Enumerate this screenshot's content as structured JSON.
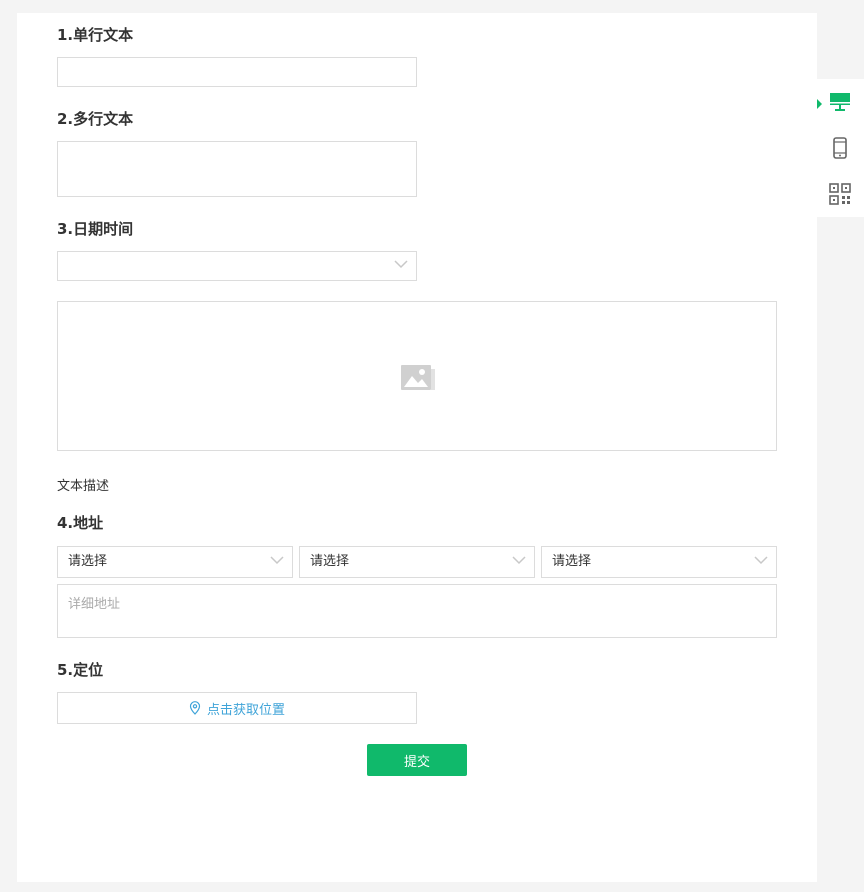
{
  "form": {
    "q1_title": "1.单行文本",
    "q2_title": "2.多行文本",
    "q3_title": "3.日期时间",
    "image_caption": "文本描述",
    "q4_title": "4.地址",
    "province_select": "请选择",
    "city_select": "请选择",
    "district_select": "请选择",
    "detail_address_placeholder": "详细地址",
    "q5_title": "5.定位",
    "locate_button_label": "点击获取位置",
    "submit_label": "提交"
  },
  "side_panel": {
    "items": [
      {
        "icon": "desktop-icon",
        "active": true
      },
      {
        "icon": "mobile-icon",
        "active": false
      },
      {
        "icon": "qrcode-icon",
        "active": false
      }
    ]
  },
  "colors": {
    "accent": "#10b96b",
    "link": "#3ea3d8",
    "border": "#dcdcdc",
    "background": "#f4f4f4"
  }
}
